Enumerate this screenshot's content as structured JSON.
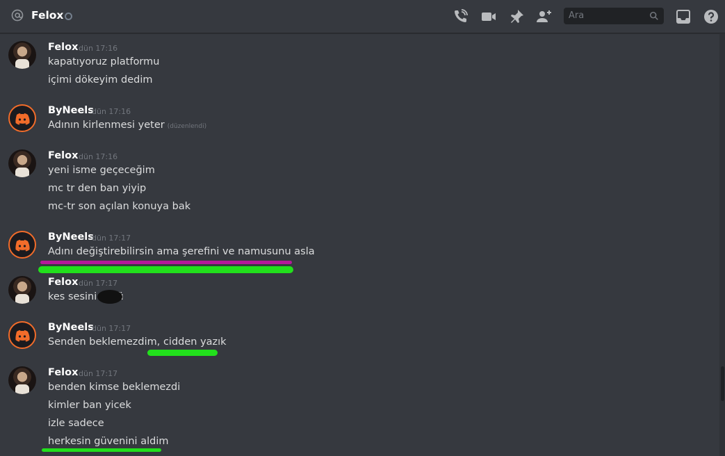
{
  "header": {
    "title": "Felox",
    "search_placeholder": "Ara"
  },
  "messages": [
    {
      "author": "Felox",
      "time": "dün 17:16",
      "lines": [
        "kapatıyoruz platformu",
        "içimi dökeyim dedim"
      ]
    },
    {
      "author": "ByNeels",
      "time": "dün 17:16",
      "lines": [
        "Adının kirlenmesi yeter"
      ],
      "edited": "(düzenlendi)"
    },
    {
      "author": "Felox",
      "time": "dün 17:16",
      "lines": [
        "yeni isme geçeceğim",
        "mc tr den ban yiyip",
        "mc-tr son açılan konuya bak"
      ]
    },
    {
      "author": "ByNeels",
      "time": "dün 17:17",
      "lines": [
        "Adını değiştirebilirsin ama şerefini ve namusunu asla"
      ]
    },
    {
      "author": "Felox",
      "time": "dün 17:17",
      "lines": [
        "kes sesini s    klü"
      ]
    },
    {
      "author": "ByNeels",
      "time": "dün 17:17",
      "lines": [
        "Senden beklemezdim, cidden yazık"
      ]
    },
    {
      "author": "Felox",
      "time": "dün 17:17",
      "lines": [
        "benden kimse beklemezdi",
        "kimler ban yicek",
        "izle sadece",
        "herkesin güvenini aldim"
      ]
    }
  ],
  "colors": {
    "highlight_green": "#22e01c",
    "highlight_magenta": "#b6189a",
    "accent_orange": "#f26c2a"
  }
}
